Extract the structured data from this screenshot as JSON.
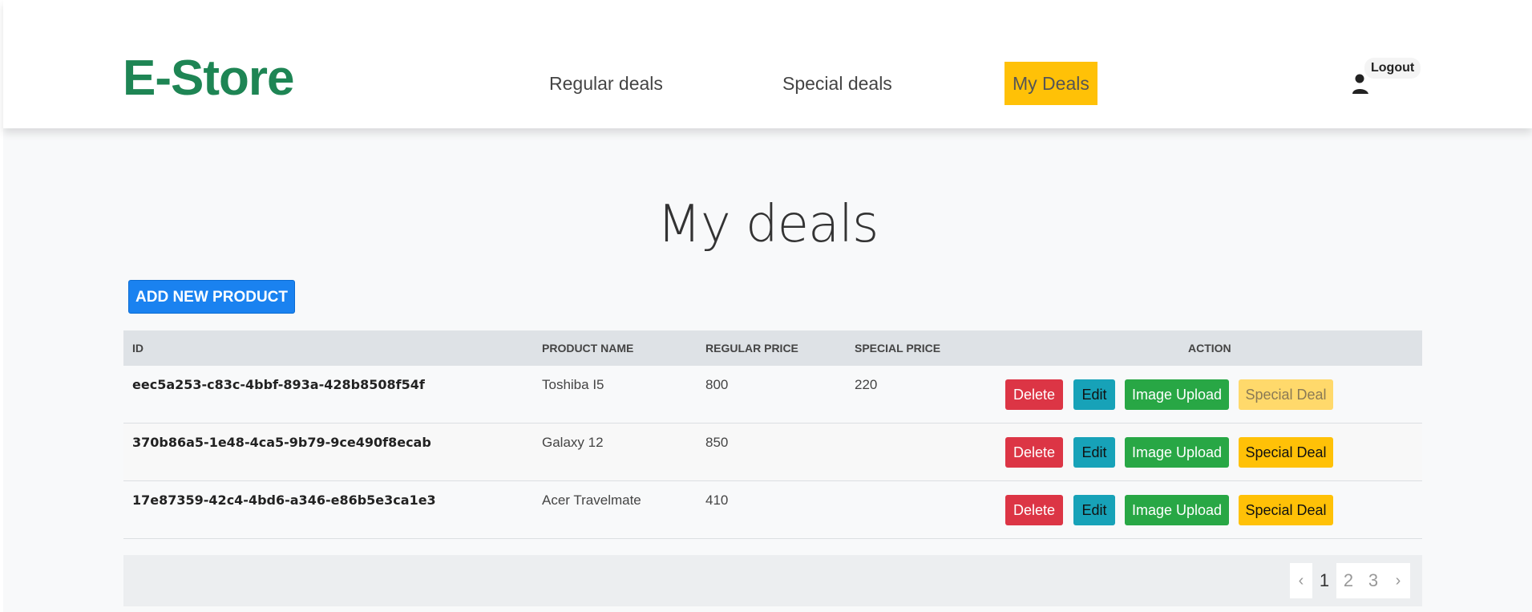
{
  "brand": "E-Store",
  "nav": {
    "regular": "Regular deals",
    "special": "Special deals",
    "mydeals": "My Deals",
    "logout": "Logout"
  },
  "page": {
    "title": "My deals",
    "add_button": "ADD NEW PRODUCT"
  },
  "table": {
    "headers": [
      "ID",
      "PRODUCT NAME",
      "REGULAR PRICE",
      "SPECIAL PRICE",
      "ACTION"
    ],
    "rows": [
      {
        "id": "eec5a253-c83c-4bbf-893a-428b8508f54f",
        "name": "Toshiba I5",
        "regular": "800",
        "special": "220",
        "special_deal_disabled": true
      },
      {
        "id": "370b86a5-1e48-4ca5-9b79-9ce490f8ecab",
        "name": "Galaxy 12",
        "regular": "850",
        "special": "",
        "special_deal_disabled": false
      },
      {
        "id": "17e87359-42c4-4bd6-a346-e86b5e3ca1e3",
        "name": "Acer Travelmate",
        "regular": "410",
        "special": "",
        "special_deal_disabled": false
      }
    ],
    "actions": {
      "delete": "Delete",
      "edit": "Edit",
      "upload": "Image Upload",
      "special": "Special Deal"
    }
  },
  "pagination": {
    "prev": "‹",
    "pages": [
      "1",
      "2",
      "3"
    ],
    "current": "1",
    "next": "›"
  },
  "colors": {
    "brand": "#1e8554",
    "active_nav": "#ffc107",
    "primary": "#1a82f0",
    "danger": "#dc3545",
    "info": "#17a2b8",
    "success": "#28a745",
    "warning": "#ffc107"
  },
  "icons": {
    "logout": "user-icon"
  }
}
